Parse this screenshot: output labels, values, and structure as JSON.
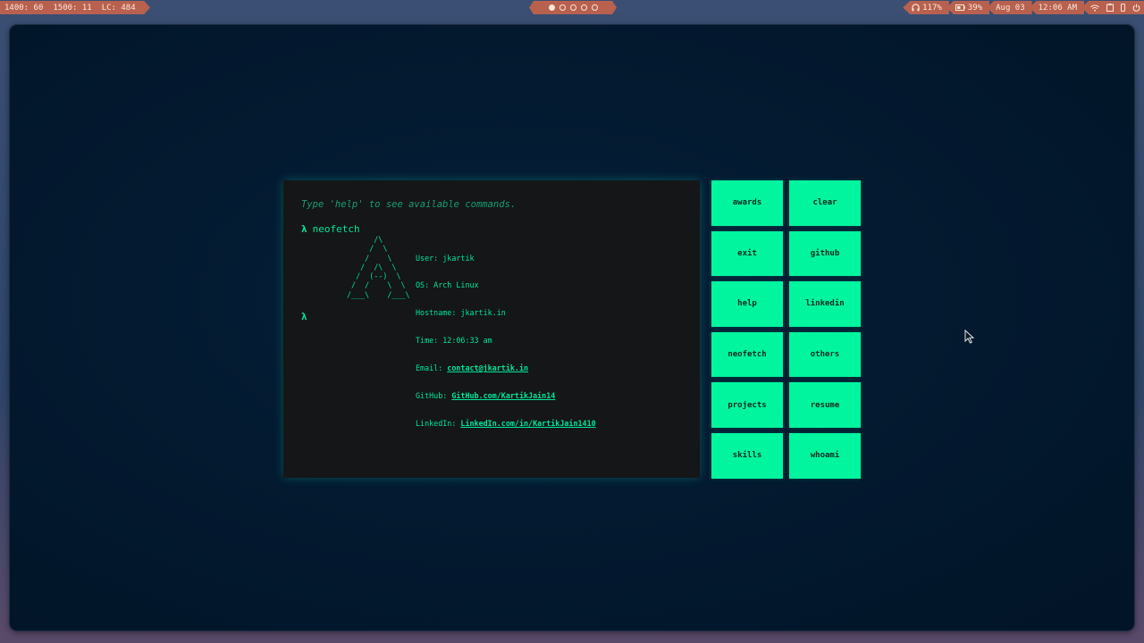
{
  "topbar": {
    "stats": [
      "1400: 60",
      "1500: 11",
      "LC: 484"
    ],
    "workspaces": [
      {
        "active": true
      },
      {
        "active": false
      },
      {
        "active": false
      },
      {
        "active": false
      },
      {
        "active": false
      }
    ],
    "volume": "117%",
    "battery": "39%",
    "date": "Aug 03",
    "time": "12:06 AM"
  },
  "terminal": {
    "hint": "Type 'help' to see available commands.",
    "prompt_symbol": "λ",
    "command": "neofetch",
    "ascii_art": "      /\\\n     /  \\\n    /    \\\n   /  /\\  \\\n  /  (--)  \\\n /  /    \\  \\\n/___\\    /___\\",
    "info": {
      "user_label": "User: ",
      "user": "jkartik",
      "os_label": "OS: ",
      "os": "Arch Linux",
      "hostname_label": "Hostname: ",
      "hostname": "jkartik.in",
      "time_label": "Time: ",
      "time": "12:06:33 am",
      "email_label": "Email: ",
      "email": "contact@jkartik.in",
      "github_label": "GitHub: ",
      "github": "GitHub.com/KartikJain14",
      "linkedin_label": "LinkedIn: ",
      "linkedin": "LinkedIn.com/in/KartikJain1410"
    }
  },
  "commands": [
    "awards",
    "clear",
    "exit",
    "github",
    "help",
    "linkedin",
    "neofetch",
    "others",
    "projects",
    "resume",
    "skills",
    "whoami"
  ],
  "colors": {
    "accent": "#00f59e",
    "terminal_bg": "#141618",
    "bar_pill": "#b8614f"
  }
}
